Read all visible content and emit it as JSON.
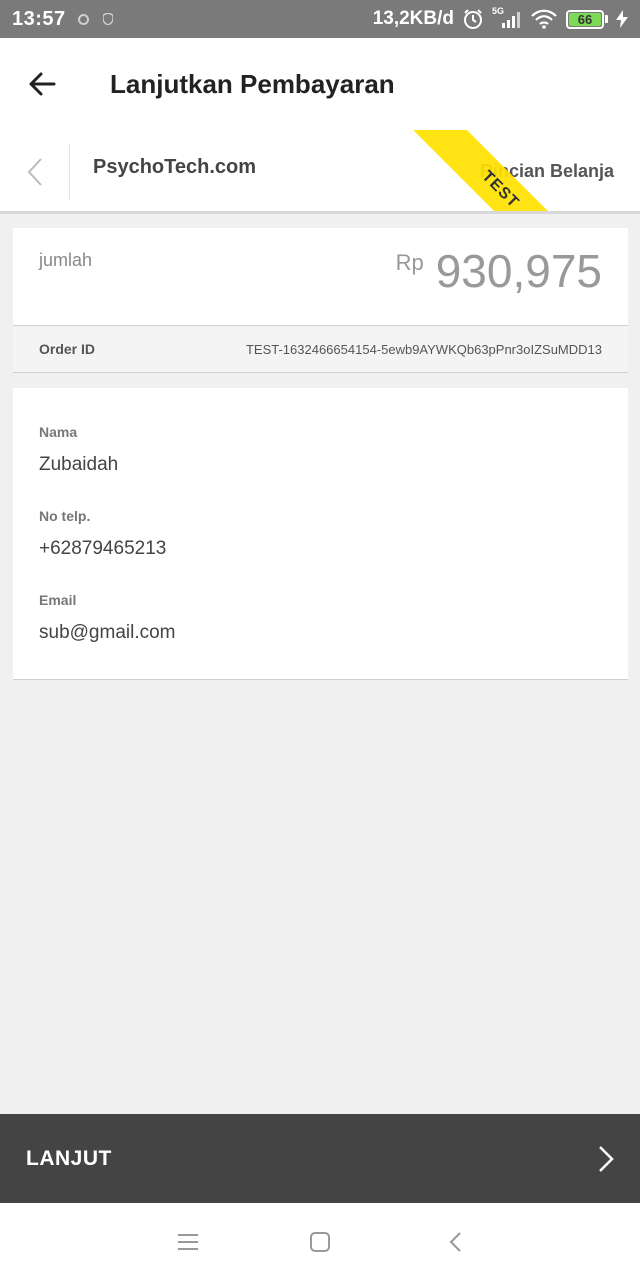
{
  "status_bar": {
    "time": "13:57",
    "network_speed": "13,2KB/d",
    "network_type": "5G",
    "battery": "66",
    "icons": [
      "alarm-icon",
      "signal-icon",
      "wifi-icon",
      "battery-icon",
      "charging-icon"
    ]
  },
  "app_bar": {
    "title": "Lanjutkan Pembayaran",
    "back_icon": "arrow-left-icon"
  },
  "merchant": {
    "name": "PsychoTech.com",
    "details_link": "Rincian Belanja",
    "ribbon": "TEST"
  },
  "amount": {
    "label": "jumlah",
    "currency": "Rp",
    "value": "930,975"
  },
  "order": {
    "label": "Order ID",
    "value": "TEST-1632466654154-5ewb9AYWKQb63pPnr3oIZSuMDD13"
  },
  "customer": {
    "name_label": "Nama",
    "name": "Zubaidah",
    "phone_label": "No telp.",
    "phone": "+62879465213",
    "email_label": "Email",
    "email": "sub@gmail.com"
  },
  "action": {
    "continue_label": "LANJUT"
  },
  "colors": {
    "ribbon": "#ffe100",
    "action_bar": "#444444",
    "status_bar": "#7a7a7a",
    "battery": "#7ed957"
  }
}
